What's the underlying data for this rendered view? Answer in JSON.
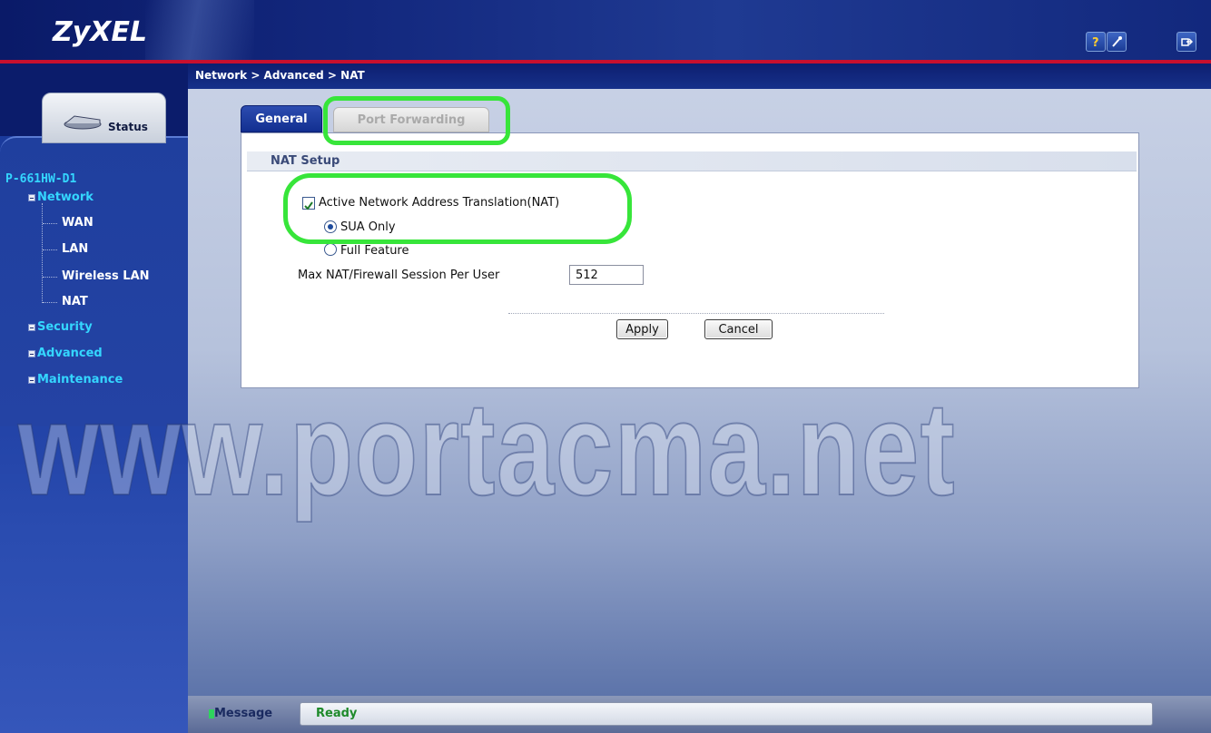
{
  "header": {
    "logo": "ZyXEL",
    "help_icon": "question-mark-icon",
    "wizard_icon": "magic-wand-icon",
    "logout_icon": "logout-icon"
  },
  "breadcrumb": "Network > Advanced > NAT",
  "sidebar": {
    "status_label": "Status",
    "device_name": "P-661HW-D1",
    "items": [
      {
        "label": "Network",
        "expanded": true,
        "children": [
          "WAN",
          "LAN",
          "Wireless LAN",
          "NAT"
        ]
      },
      {
        "label": "Security",
        "expanded": false
      },
      {
        "label": "Advanced",
        "expanded": false
      },
      {
        "label": "Maintenance",
        "expanded": false
      }
    ]
  },
  "tabs": [
    {
      "label": "General",
      "active": true
    },
    {
      "label": "Port Forwarding",
      "active": false,
      "disabled": true
    }
  ],
  "nat_setup": {
    "section_title": "NAT Setup",
    "active_nat_label": "Active Network Address Translation(NAT)",
    "active_nat_checked": true,
    "options": [
      {
        "label": "SUA Only",
        "selected": true
      },
      {
        "label": "Full Feature",
        "selected": false
      }
    ],
    "max_session_label": "Max NAT/Firewall Session Per User",
    "max_session_value": "512"
  },
  "buttons": {
    "apply": "Apply",
    "cancel": "Cancel"
  },
  "status": {
    "message_label": "Message",
    "message_text": "Ready"
  },
  "watermark": "www.portacma.net",
  "colors": {
    "accent_cyan": "#34d6ff",
    "header_red": "#c8102e",
    "highlight_green": "#37e53a",
    "status_green": "#1e8a2a"
  }
}
